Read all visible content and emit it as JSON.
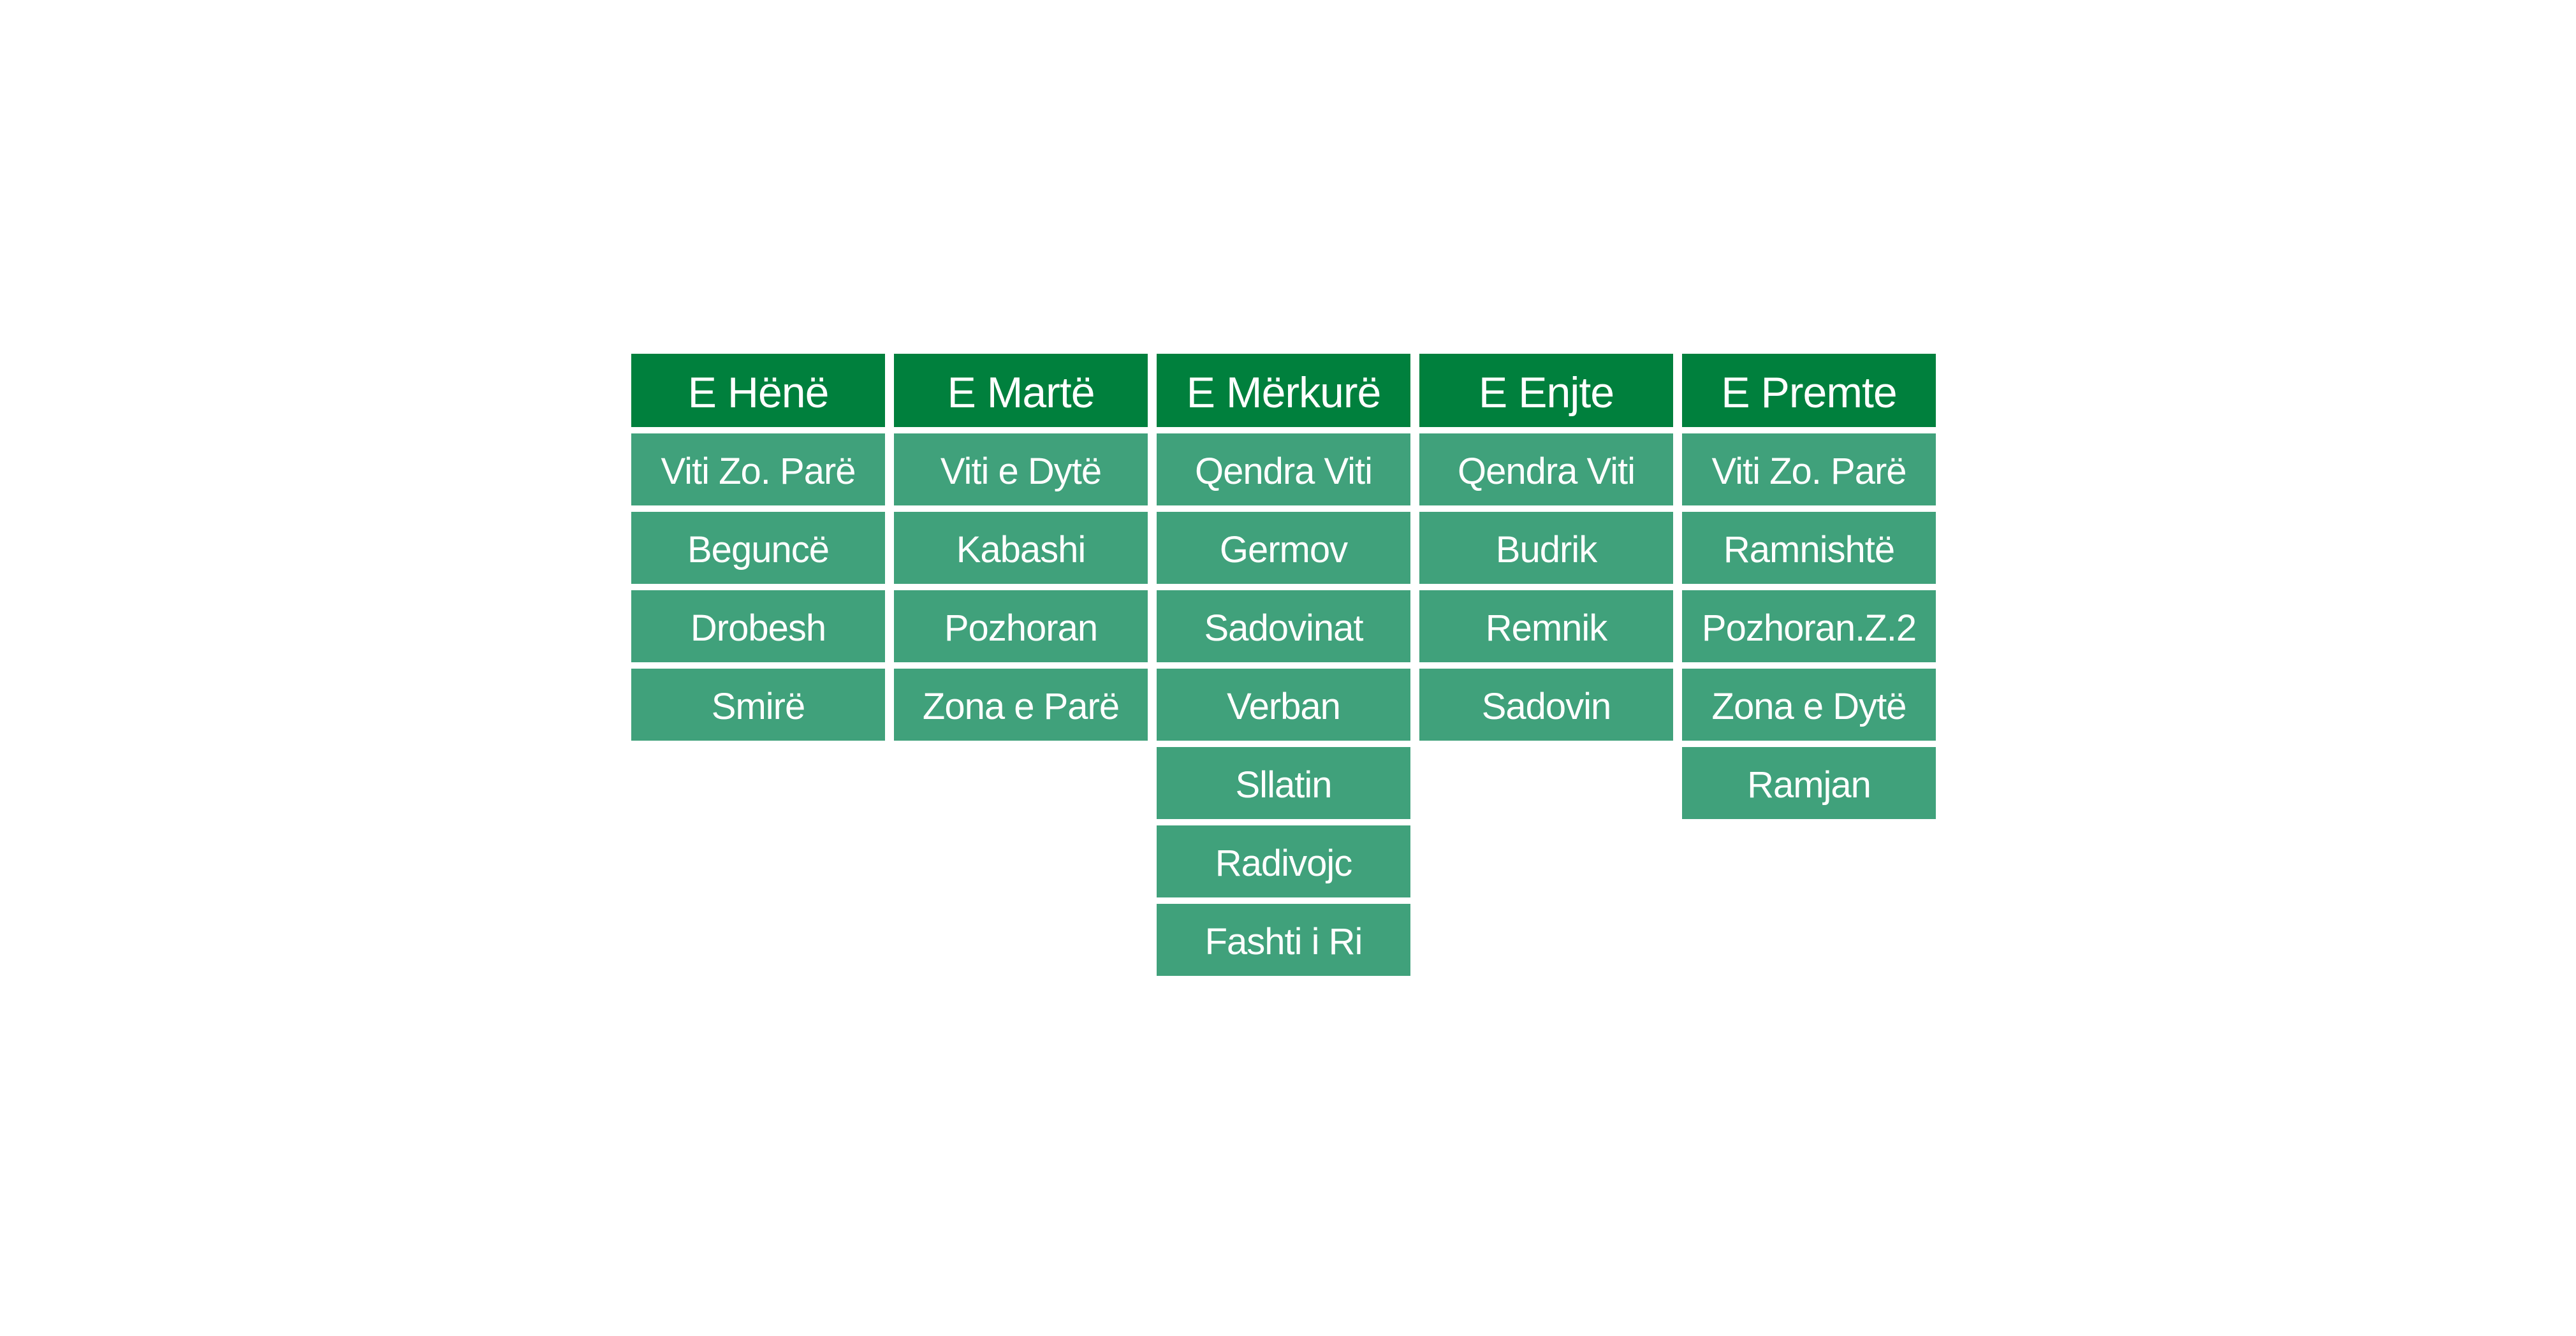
{
  "colors": {
    "header_bg": "#00803d",
    "cell_bg": "#40a17b",
    "text": "#ffffff",
    "page_bg": "#ffffff"
  },
  "days": [
    {
      "name": "E Hënë",
      "villages": [
        "Viti Zo. Parë",
        "Beguncë",
        "Drobesh",
        "Smirë"
      ]
    },
    {
      "name": "E Martë",
      "villages": [
        "Viti e Dytë",
        "Kabashi",
        "Pozhoran",
        "Zona e Parë"
      ]
    },
    {
      "name": "E Mërkurë",
      "villages": [
        "Qendra Viti",
        "Germov",
        "Sadovinat",
        "Verban",
        "Sllatin",
        "Radivojc",
        "Fashti i Ri"
      ]
    },
    {
      "name": "E Enjte",
      "villages": [
        "Qendra Viti",
        "Budrik",
        "Remnik",
        "Sadovin"
      ]
    },
    {
      "name": "E Premte",
      "villages": [
        "Viti Zo. Parë",
        "Ramnishtë",
        "Pozhoran.Z.2",
        "Zona e Dytë",
        "Ramjan"
      ]
    }
  ]
}
